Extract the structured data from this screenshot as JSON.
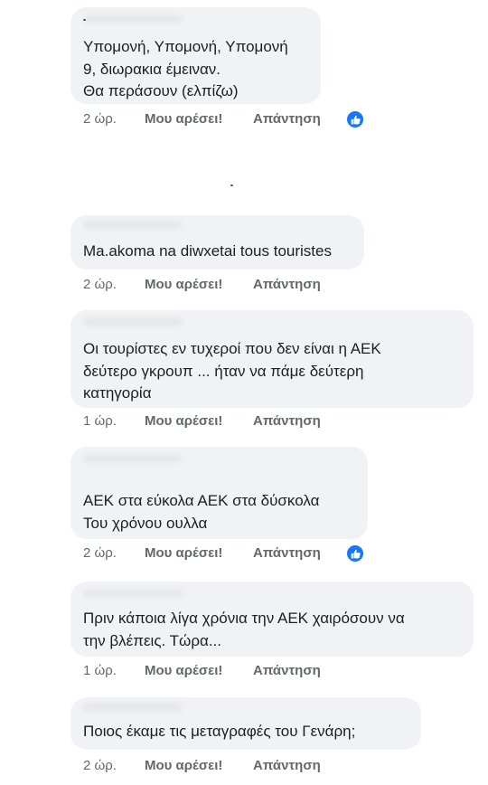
{
  "comments": [
    {
      "text": "Υπομονή, Υπομονή, Υπομονή\n9, διωρακια έμειναν.\nΘα περάσουν (ελπίζω)",
      "time": "2 ώρ.",
      "like_label": "Μου αρέσει!",
      "reply_label": "Απάντηση",
      "reactions": "1"
    },
    {
      "text": "Ma.akoma na diwxetai tous touristes",
      "time": "2 ώρ.",
      "like_label": "Μου αρέσει!",
      "reply_label": "Απάντηση"
    },
    {
      "text": "Οι τουρίστες εν τυχεροί που δεν είναι η ΑΕΚ\nδεύτερο γκρουπ ... ήταν να πάμε δεύτερη\nκατηγορία",
      "time": "1 ώρ.",
      "like_label": "Μου αρέσει!",
      "reply_label": "Απάντηση"
    },
    {
      "text": "ΑΕΚ στα εύκολα ΑΕΚ στα δύσκολα\nΤου χρόνου ουλλα",
      "time": "2 ώρ.",
      "like_label": "Μου αρέσει!",
      "reply_label": "Απάντηση",
      "reactions": "1"
    },
    {
      "text": "Πριν κάποια λίγα χρόνια την ΑΕΚ χαιρόσουν να\nτην βλέπεις. Τώρα...",
      "time": "1 ώρ.",
      "like_label": "Μου αρέσει!",
      "reply_label": "Απάντηση"
    },
    {
      "text": "Ποιος έκαμε τις μεταγραφές του Γενάρη;",
      "time": "2 ώρ.",
      "like_label": "Μου αρέσει!",
      "reply_label": "Απάντηση"
    }
  ],
  "icons": {
    "reaction": "like-thumb-icon"
  },
  "colors": {
    "bubble": "#f0f2f5",
    "secondary_text": "#65676b",
    "like_blue": "#1877f2"
  }
}
